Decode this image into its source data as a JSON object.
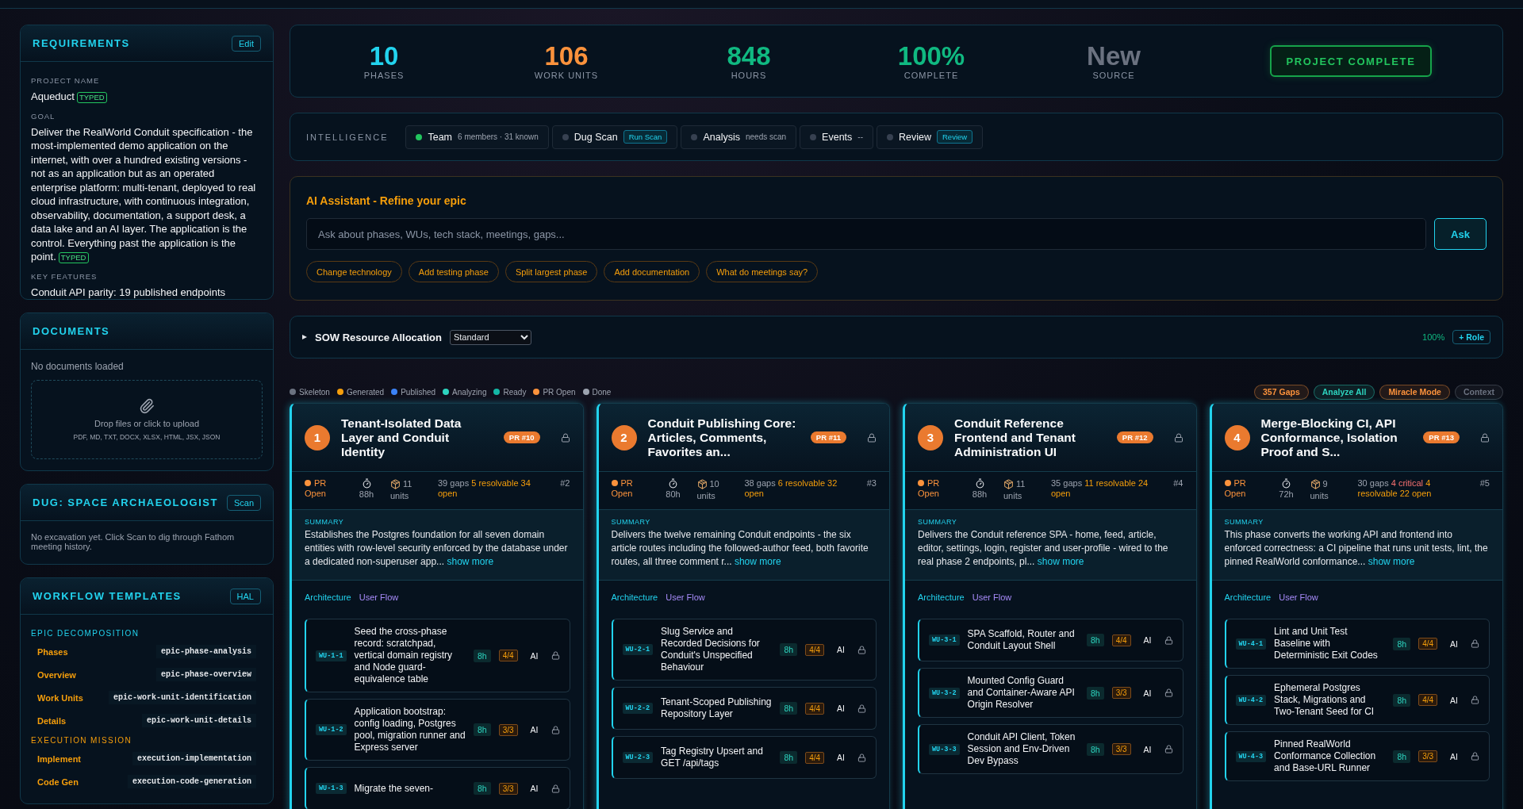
{
  "sidebar": {
    "requirements": {
      "title": "REQUIREMENTS",
      "action": "Edit",
      "fields": [
        {
          "label": "PROJECT NAME",
          "value": "Aqueduct",
          "tag": "TYPED"
        },
        {
          "label": "GOAL",
          "value": "Deliver the RealWorld Conduit specification - the most-implemented demo application on the internet, with over a hundred existing versions - not as an application but as an operated enterprise platform: multi-tenant, deployed to real cloud infrastructure, with continuous integration, observability, documentation, a support desk, a data lake and an AI layer. The application is the control. Everything past the application is the point.",
          "tag": "TYPED"
        },
        {
          "label": "KEY FEATURES",
          "value": "Conduit API parity: 19 published endpoints"
        }
      ]
    },
    "documents": {
      "title": "DOCUMENTS",
      "empty_text": "No documents loaded",
      "upload_text": "Drop files or click to upload",
      "formats": "PDF, MD, TXT, DOCX, XLSX, HTML, JSX, JSON"
    },
    "dug": {
      "title": "DUG: SPACE ARCHAEOLOGIST",
      "action": "Scan",
      "text": "No excavation yet. Click Scan to dig through Fathom meeting history."
    },
    "workflow_templates": {
      "title": "WORKFLOW TEMPLATES",
      "action": "HAL",
      "groups": [
        {
          "name": "EPIC DECOMPOSITION",
          "color": "#22d3ee",
          "items": [
            {
              "label": "Phases",
              "template": "epic-phase-analysis"
            },
            {
              "label": "Overview",
              "template": "epic-phase-overview"
            },
            {
              "label": "Work Units",
              "template": "epic-work-unit-identification"
            },
            {
              "label": "Details",
              "template": "epic-work-unit-details"
            }
          ]
        },
        {
          "name": "EXECUTION MISSION",
          "color": "#f59e0b",
          "items": [
            {
              "label": "Implement",
              "template": "execution-implementation"
            },
            {
              "label": "Code Gen",
              "template": "execution-code-generation"
            }
          ]
        }
      ]
    }
  },
  "stats": [
    {
      "value": "10",
      "label": "PHASES",
      "color": "#22d3ee"
    },
    {
      "value": "106",
      "label": "WORK UNITS",
      "color": "#fb923c"
    },
    {
      "value": "848",
      "label": "HOURS",
      "color": "#10b981"
    },
    {
      "value": "100%",
      "label": "COMPLETE",
      "color": "#10b981"
    },
    {
      "value": "New",
      "label": "SOURCE",
      "color": "#6b7280"
    }
  ],
  "status_button": "PROJECT COMPLETE",
  "intelligence": {
    "label": "INTELLIGENCE",
    "items": [
      {
        "name": "Team",
        "color": "#22c55e",
        "detail": "6 members · 31 known",
        "kind": "text"
      },
      {
        "name": "Dug Scan",
        "color": "#374151",
        "detail": "Run Scan",
        "kind": "badge"
      },
      {
        "name": "Analysis",
        "color": "#374151",
        "detail": "needs scan",
        "kind": "text"
      },
      {
        "name": "Events",
        "color": "#374151",
        "detail": "--",
        "kind": "text"
      },
      {
        "name": "Review",
        "color": "#374151",
        "detail": "Review",
        "kind": "badge"
      }
    ]
  },
  "assistant": {
    "title": "AI Assistant - Refine your epic",
    "placeholder": "Ask about phases, WUs, tech stack, meetings, gaps...",
    "button": "Ask",
    "suggestions": [
      "Change technology",
      "Add testing phase",
      "Split largest phase",
      "Add documentation",
      "What do meetings say?"
    ]
  },
  "sow": {
    "title": "SOW Resource Allocation",
    "expanded": false,
    "select": "Standard",
    "percent": "100%",
    "button": "+ Role"
  },
  "legend": [
    {
      "label": "Skeleton",
      "color": "#6b7280"
    },
    {
      "label": "Generated",
      "color": "#f59e0b"
    },
    {
      "label": "Published",
      "color": "#3b82f6"
    },
    {
      "label": "Analyzing",
      "color": "#2dd4bf"
    },
    {
      "label": "Ready",
      "color": "#14b8a6"
    },
    {
      "label": "PR Open",
      "color": "#fb923c"
    },
    {
      "label": "Done",
      "color": "#9ca3af"
    }
  ],
  "toolbar": [
    {
      "label": "357 Gaps",
      "color": "#fb923c"
    },
    {
      "label": "Analyze All",
      "color": "#2dd4bf"
    },
    {
      "label": "Miracle Mode",
      "color": "#fb923c"
    },
    {
      "label": "Context",
      "color": "#6b7280"
    }
  ],
  "phases": [
    {
      "number": "1",
      "title": "Tenant-Isolated Data Layer and Conduit Identity",
      "pr": "PR #10",
      "status": {
        "text": "PR Open",
        "color": "#fb923c"
      },
      "hours": "88h",
      "units": "11",
      "units_label": "units",
      "gaps": [
        {
          "text": "39 gaps",
          "kind": "plain"
        },
        {
          "text": "5 resolvable 34 open",
          "kind": "resolvable"
        }
      ],
      "index": "#2",
      "summary_label": "SUMMARY",
      "summary": "Establishes the Postgres foundation for all seven domain entities with row-level security enforced by the database under a dedicated non-superuser app...",
      "show_more": "show more",
      "tabs": [
        {
          "label": "Architecture",
          "selected": true
        },
        {
          "label": "User Flow",
          "selected": false
        }
      ],
      "work_units": [
        {
          "id": "WU-1-1",
          "title": "Seed the cross-phase record: scratchpad, vertical domain registry and Node guard-equivalence table",
          "hours": "8h",
          "checks": "4/4",
          "ai": "AI"
        },
        {
          "id": "WU-1-2",
          "title": "Application bootstrap: config loading, Postgres pool, migration runner and Express server",
          "hours": "8h",
          "checks": "3/3",
          "ai": "AI"
        },
        {
          "id": "WU-1-3",
          "title": "Migrate the seven-",
          "hours": "8h",
          "checks": "3/3",
          "ai": "AI"
        }
      ]
    },
    {
      "number": "2",
      "title": "Conduit Publishing Core: Articles, Comments, Favorites an...",
      "pr": "PR #11",
      "status": {
        "text": "PR Open",
        "color": "#fb923c"
      },
      "hours": "80h",
      "units": "10",
      "units_label": "units",
      "gaps": [
        {
          "text": "38 gaps",
          "kind": "plain"
        },
        {
          "text": "6 resolvable 32 open",
          "kind": "resolvable"
        }
      ],
      "index": "#3",
      "summary_label": "SUMMARY",
      "summary": "Delivers the twelve remaining Conduit endpoints - the six article routes including the followed-author feed, both favorite routes, all three comment r...",
      "show_more": "show more",
      "tabs": [
        {
          "label": "Architecture",
          "selected": true
        },
        {
          "label": "User Flow",
          "selected": false
        }
      ],
      "work_units": [
        {
          "id": "WU-2-1",
          "title": "Slug Service and Recorded Decisions for Conduit's Unspecified Behaviour",
          "hours": "8h",
          "checks": "4/4",
          "ai": "AI"
        },
        {
          "id": "WU-2-2",
          "title": "Tenant-Scoped Publishing Repository Layer",
          "hours": "8h",
          "checks": "4/4",
          "ai": "AI"
        },
        {
          "id": "WU-2-3",
          "title": "Tag Registry Upsert and GET /api/tags",
          "hours": "8h",
          "checks": "4/4",
          "ai": "AI"
        }
      ]
    },
    {
      "number": "3",
      "title": "Conduit Reference Frontend and Tenant Administration UI",
      "pr": "PR #12",
      "status": {
        "text": "PR Open",
        "color": "#fb923c"
      },
      "hours": "88h",
      "units": "11",
      "units_label": "units",
      "gaps": [
        {
          "text": "35 gaps",
          "kind": "plain"
        },
        {
          "text": "11 resolvable 24 open",
          "kind": "resolvable"
        }
      ],
      "index": "#4",
      "summary_label": "SUMMARY",
      "summary": "Delivers the Conduit reference SPA - home, feed, article, editor, settings, login, register and user-profile - wired to the real phase 2 endpoints, pl...",
      "show_more": "show more",
      "tabs": [
        {
          "label": "Architecture",
          "selected": true
        },
        {
          "label": "User Flow",
          "selected": false
        }
      ],
      "work_units": [
        {
          "id": "WU-3-1",
          "title": "SPA Scaffold, Router and Conduit Layout Shell",
          "hours": "8h",
          "checks": "4/4",
          "ai": "AI"
        },
        {
          "id": "WU-3-2",
          "title": "Mounted Config Guard and Container-Aware API Origin Resolver",
          "hours": "8h",
          "checks": "3/3",
          "ai": "AI"
        },
        {
          "id": "WU-3-3",
          "title": "Conduit API Client, Token Session and Env-Driven Dev Bypass",
          "hours": "8h",
          "checks": "3/3",
          "ai": "AI"
        }
      ]
    },
    {
      "number": "4",
      "title": "Merge-Blocking CI, API Conformance, Isolation Proof and S...",
      "pr": "PR #13",
      "status": {
        "text": "PR Open",
        "color": "#fb923c"
      },
      "hours": "72h",
      "units": "9",
      "units_label": "units",
      "gaps": [
        {
          "text": "30 gaps",
          "kind": "plain"
        },
        {
          "text": "4 critical",
          "kind": "critical"
        },
        {
          "text": "4 resolvable 22 open",
          "kind": "resolvable"
        }
      ],
      "index": "#5",
      "summary_label": "SUMMARY",
      "summary": "This phase converts the working API and frontend into enforced correctness: a CI pipeline that runs unit tests, lint, the pinned RealWorld conformance...",
      "show_more": "show more",
      "tabs": [
        {
          "label": "Architecture",
          "selected": true
        },
        {
          "label": "User Flow",
          "selected": false
        }
      ],
      "work_units": [
        {
          "id": "WU-4-1",
          "title": "Lint and Unit Test Baseline with Deterministic Exit Codes",
          "hours": "8h",
          "checks": "4/4",
          "ai": "AI"
        },
        {
          "id": "WU-4-2",
          "title": "Ephemeral Postgres Stack, Migrations and Two-Tenant Seed for CI",
          "hours": "8h",
          "checks": "4/4",
          "ai": "AI"
        },
        {
          "id": "WU-4-3",
          "title": "Pinned RealWorld Conformance Collection and Base-URL Runner",
          "hours": "8h",
          "checks": "3/3",
          "ai": "AI"
        }
      ]
    }
  ]
}
